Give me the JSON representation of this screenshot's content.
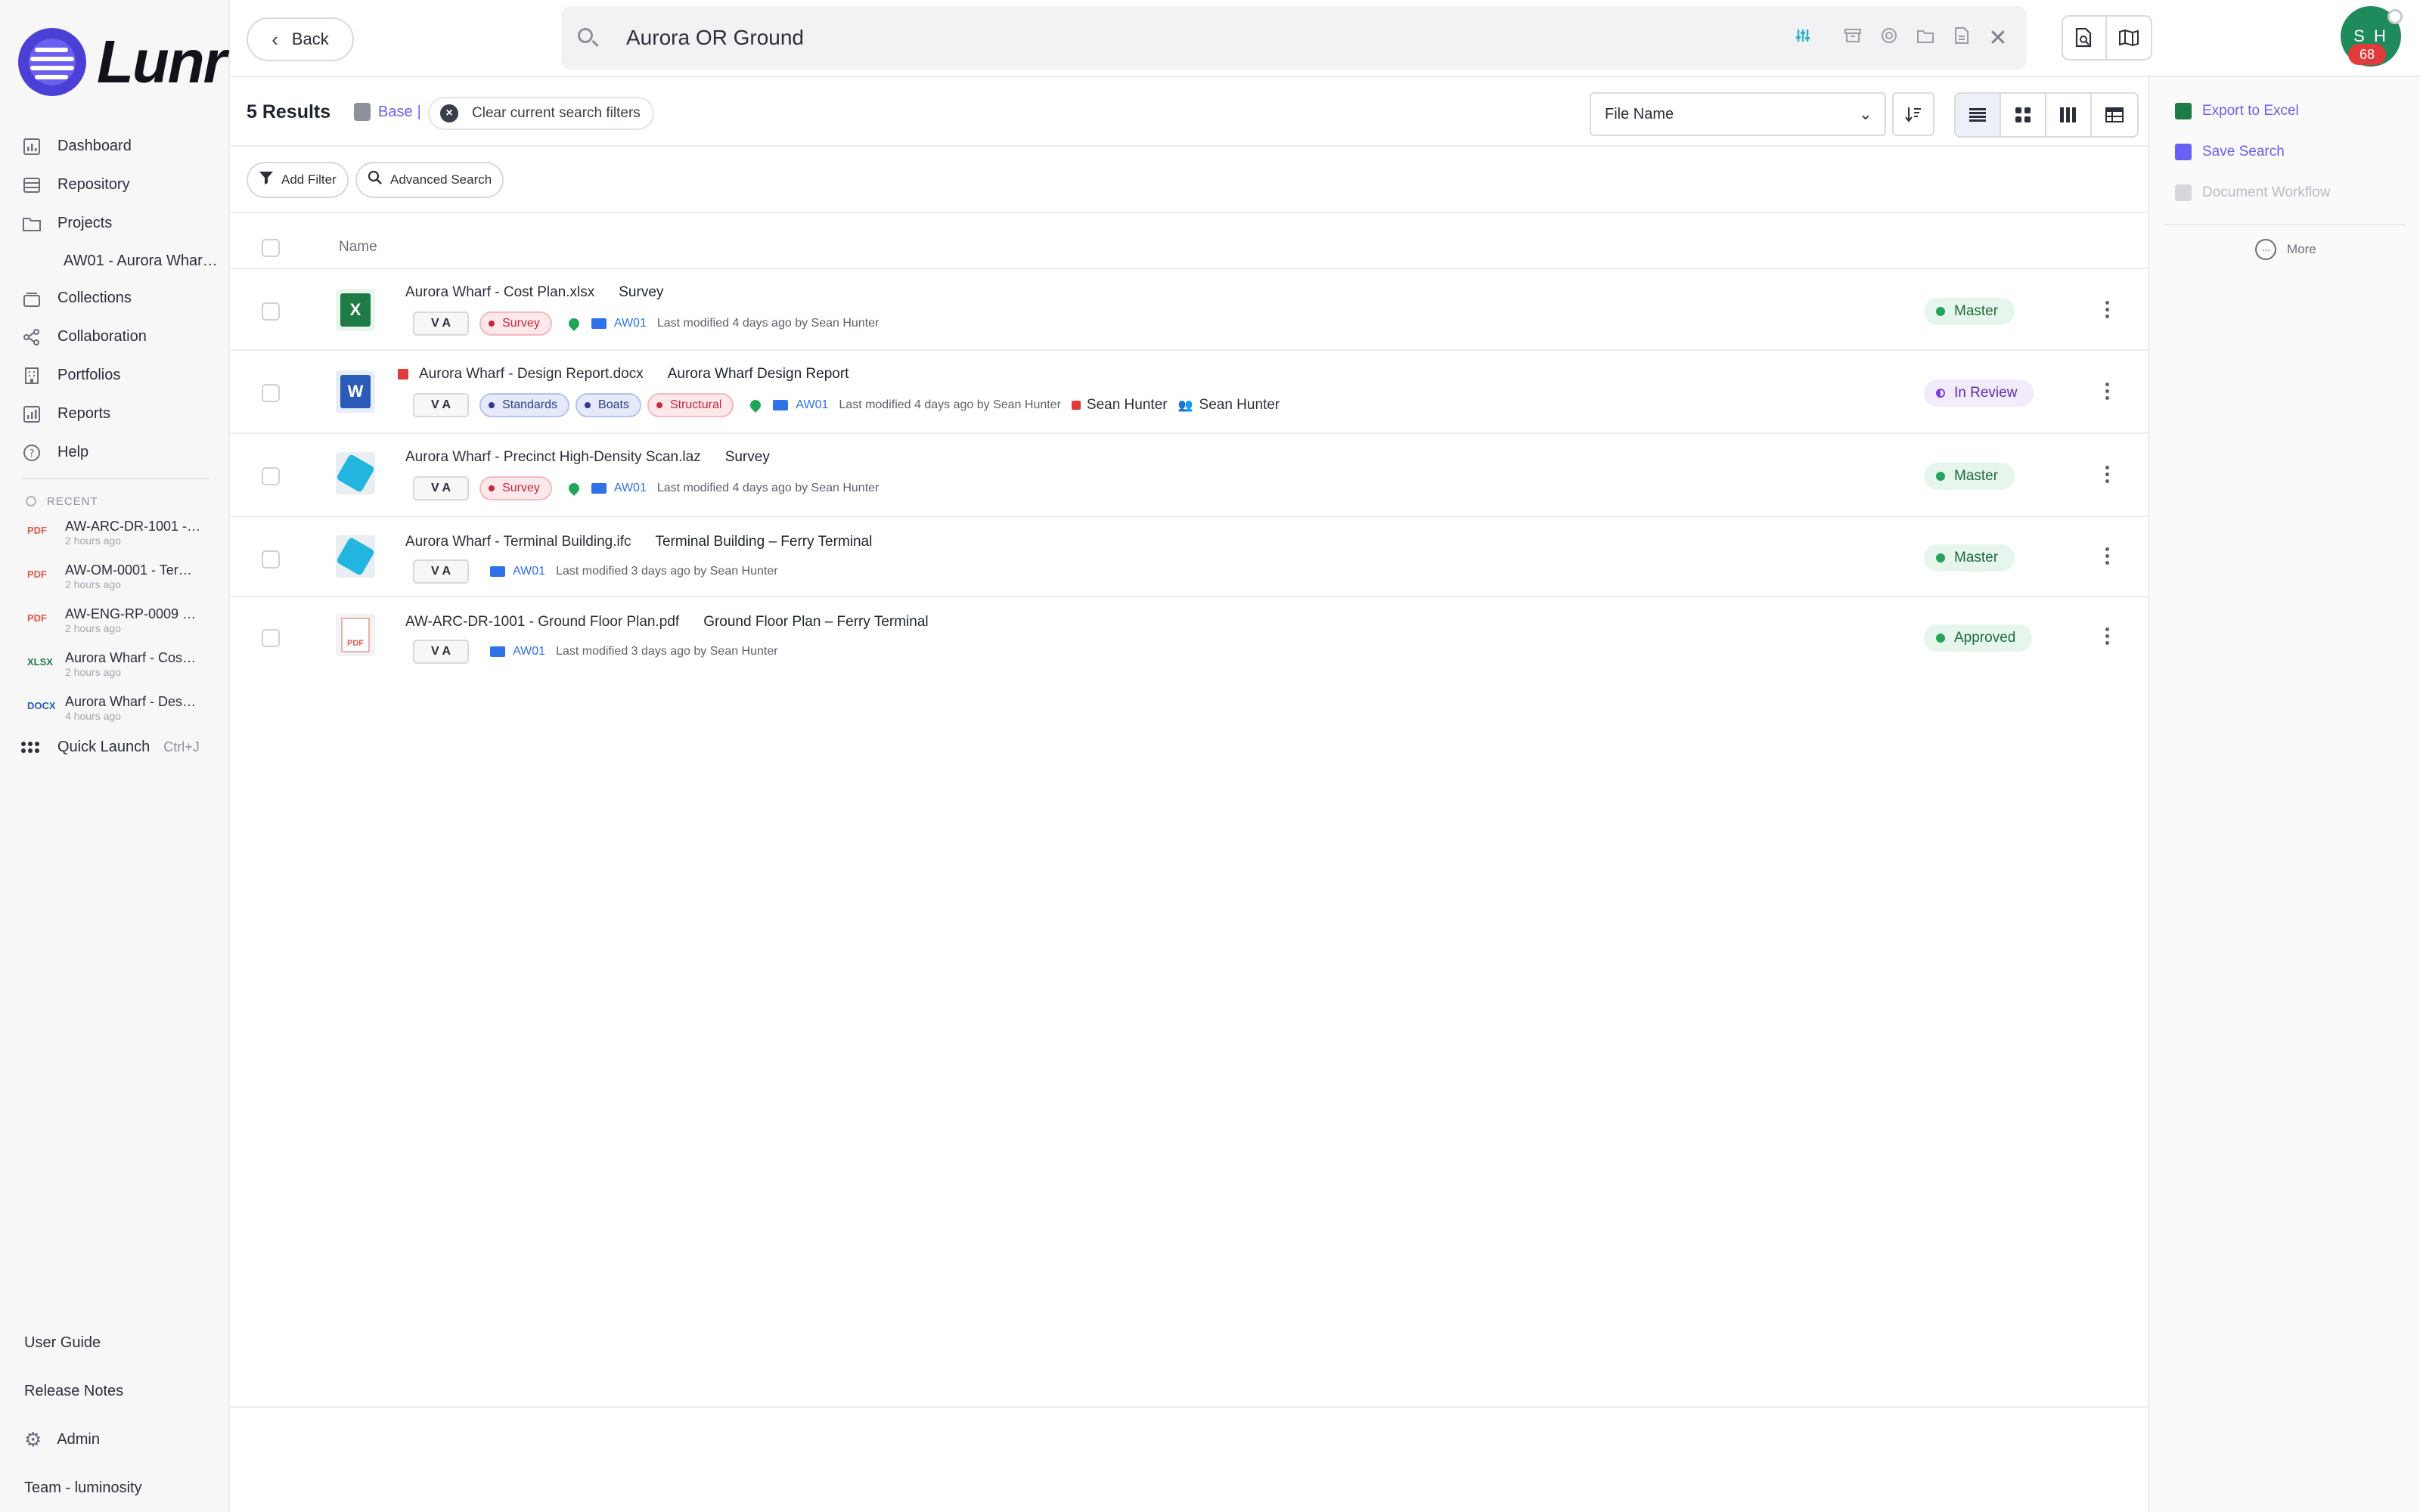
{
  "brand": {
    "name": "Lunr"
  },
  "nav": {
    "items": [
      {
        "label": "Dashboard",
        "icon": "chart-icon"
      },
      {
        "label": "Repository",
        "icon": "archive-icon"
      },
      {
        "label": "Projects",
        "icon": "folder-icon"
      }
    ],
    "project_sub": "AW01 - Aurora Whar…",
    "items2": [
      {
        "label": "Collections",
        "icon": "stack-icon"
      },
      {
        "label": "Collaboration",
        "icon": "share-icon"
      },
      {
        "label": "Portfolios",
        "icon": "building-icon"
      },
      {
        "label": "Reports",
        "icon": "report-icon"
      },
      {
        "label": "Help",
        "icon": "help-icon"
      }
    ]
  },
  "recent": {
    "title": "RECENT",
    "items": [
      {
        "type": "PDF",
        "name": "AW-ARC-DR-1001 -…",
        "time": "2 hours ago"
      },
      {
        "type": "PDF",
        "name": "AW-OM-0001 - Ter…",
        "time": "2 hours ago"
      },
      {
        "type": "PDF",
        "name": "AW-ENG-RP-0009 …",
        "time": "2 hours ago"
      },
      {
        "type": "XLSX",
        "name": "Aurora Wharf - Cos…",
        "time": "2 hours ago"
      },
      {
        "type": "DOCX",
        "name": "Aurora Wharf - Des…",
        "time": "4 hours ago"
      }
    ]
  },
  "quick_launch": {
    "label": "Quick Launch",
    "shortcut": "Ctrl+J"
  },
  "bottom": {
    "user_guide": "User Guide",
    "release_notes": "Release Notes",
    "admin": "Admin",
    "team": "Team - luminosity"
  },
  "topbar": {
    "back_label": "Back",
    "search_value": "Aurora OR Ground",
    "avatar_initials": "S H",
    "notification_count": "68"
  },
  "results": {
    "count_label": "5 Results",
    "base_label": "Base",
    "base_separator": "|",
    "clear_filters_label": "Clear current search filters",
    "sort_field": "File Name",
    "add_filter_label": "Add Filter",
    "advanced_search_label": "Advanced Search",
    "column_name": "Name"
  },
  "rows": [
    {
      "filename": "Aurora Wharf - Cost Plan.xlsx",
      "title": "Survey",
      "file_icon": "xlsx-icon",
      "version": "V A",
      "tags": [
        {
          "label": "Survey",
          "color": "#c4283d"
        }
      ],
      "project": "AW01",
      "modified": "Last modified 4 days ago by Sean Hunter",
      "status": "Master",
      "status_color": "#22a45b"
    },
    {
      "filename": "Aurora Wharf - Design Report.docx",
      "title": "Aurora Wharf Design Report",
      "file_icon": "docx-icon",
      "version": "V A",
      "tags": [
        {
          "label": "Standards",
          "color": "#2b3b8f"
        },
        {
          "label": "Boats",
          "color": "#2b3b8f"
        },
        {
          "label": "Structural",
          "color": "#c4283d"
        }
      ],
      "project": "AW01",
      "modified": "Last modified 4 days ago by Sean Hunter",
      "reviewer": "Sean Hunter",
      "group": "Sean Hunter",
      "status": "In Review",
      "status_color": "#7c3fd8"
    },
    {
      "filename": "Aurora Wharf - Precinct High-Density Scan.laz",
      "title": "Survey",
      "file_icon": "pointcloud-icon",
      "version": "V A",
      "tags": [
        {
          "label": "Survey",
          "color": "#c4283d"
        }
      ],
      "project": "AW01",
      "modified": "Last modified 4 days ago by Sean Hunter",
      "status": "Master",
      "status_color": "#22a45b"
    },
    {
      "filename": "Aurora Wharf - Terminal Building.ifc",
      "title": "Terminal Building – Ferry Terminal",
      "file_icon": "ifc-icon",
      "version": "V A",
      "tags": [],
      "project": "AW01",
      "modified": "Last modified 3 days ago by Sean Hunter",
      "status": "Master",
      "status_color": "#22a45b"
    },
    {
      "filename": "AW-ARC-DR-1001 - Ground Floor Plan.pdf",
      "title": "Ground Floor Plan – Ferry Terminal",
      "file_icon": "pdf-icon",
      "version": "V A",
      "tags": [],
      "project": "AW01",
      "modified": "Last modified 3 days ago by Sean Hunter",
      "status": "Approved",
      "status_color": "#22a45b"
    }
  ],
  "right_panel": {
    "export_excel": "Export to Excel",
    "save_search": "Save Search",
    "document_workflow": "Document Workflow",
    "more": "More"
  },
  "colors": {
    "accent": "#6a5ff0",
    "brand": "#4b3fd6",
    "link_blue": "#2f72e8",
    "status_green": "#22a45b",
    "status_purple": "#7c3fd8",
    "tag_red": "#c4283d"
  }
}
